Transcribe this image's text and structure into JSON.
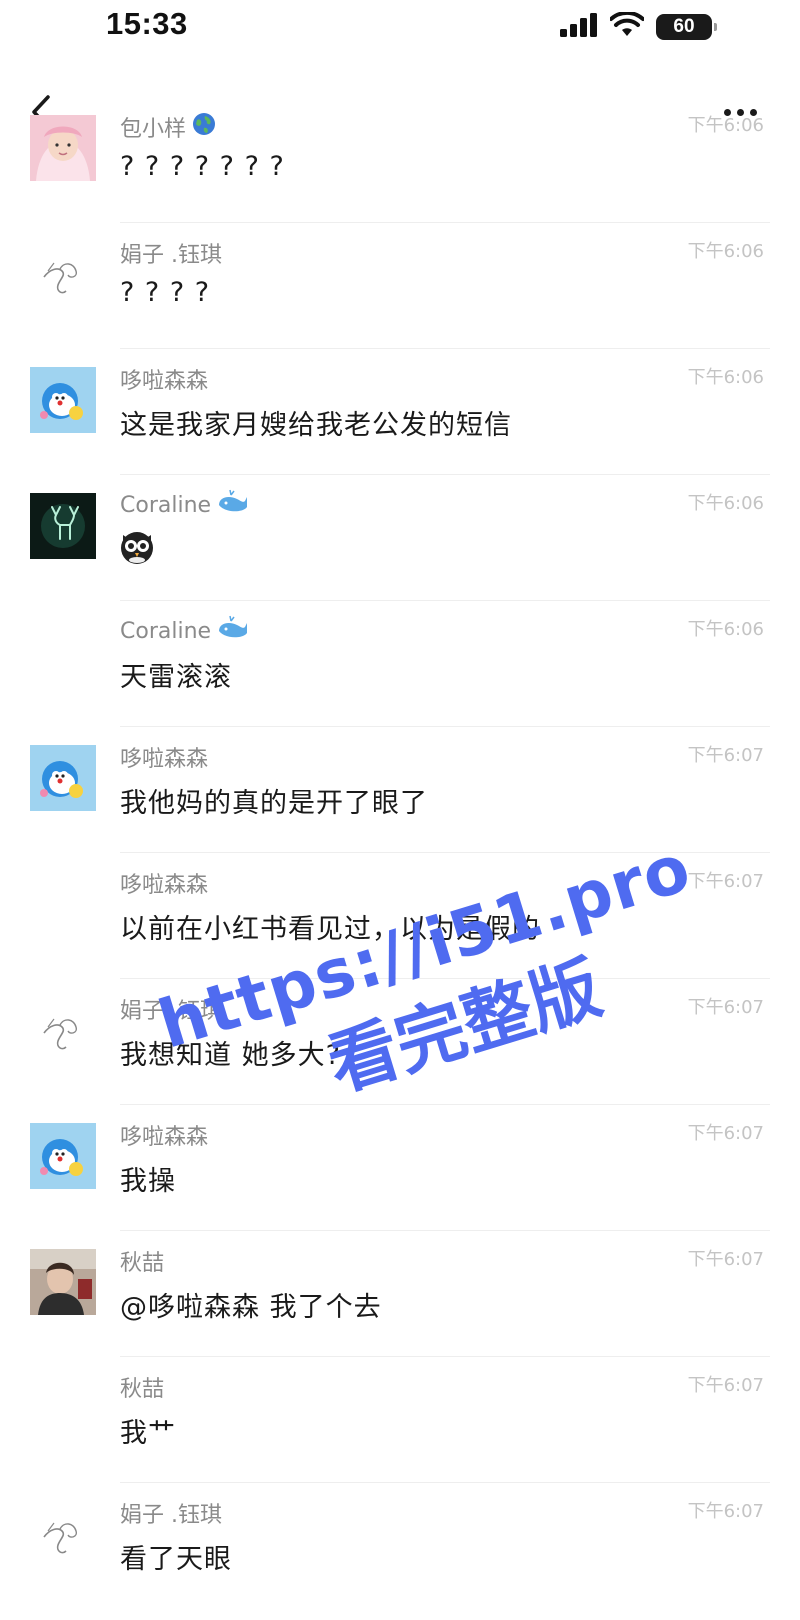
{
  "status_bar": {
    "time": "15:33",
    "battery": "60",
    "icons": [
      "signal-icon",
      "wifi-icon",
      "battery-icon"
    ]
  },
  "header": {
    "back_icon": "chevron-left-icon",
    "more_icon": "ellipsis-icon"
  },
  "messages": [
    {
      "name": "包小样",
      "badge": "globe-icon",
      "time": "下午6:06",
      "text": "? ? ? ? ? ? ?",
      "avatar": "baby-photo"
    },
    {
      "name": "娟子 .钰琪",
      "badge": "",
      "time": "下午6:06",
      "text": "? ? ? ?",
      "avatar": "sketch-logo"
    },
    {
      "name": "哆啦森森",
      "badge": "",
      "time": "下午6:06",
      "text": "这是我家月嫂给我老公发的短信",
      "avatar": "cartoon-blue"
    },
    {
      "name": "Coraline",
      "badge": "whale-icon",
      "time": "下午6:06",
      "text": "",
      "sticker": "owl-sticker",
      "avatar": "deer-photo"
    },
    {
      "name": "Coraline",
      "badge": "whale-icon",
      "time": "下午6:06",
      "text": "天雷滚滚",
      "avatar": ""
    },
    {
      "name": "哆啦森森",
      "badge": "",
      "time": "下午6:07",
      "text": "我他妈的真的是开了眼了",
      "avatar": "cartoon-blue"
    },
    {
      "name": "哆啦森森",
      "badge": "",
      "time": "下午6:07",
      "text": "以前在小红书看见过，以为是假的",
      "avatar": ""
    },
    {
      "name": "娟子 .钰琪",
      "badge": "",
      "time": "下午6:07",
      "text": "我想知道 她多大?",
      "avatar": "sketch-logo"
    },
    {
      "name": "哆啦森森",
      "badge": "",
      "time": "下午6:07",
      "text": "我操",
      "avatar": "cartoon-blue"
    },
    {
      "name": "秋喆",
      "badge": "",
      "time": "下午6:07",
      "text": "@哆啦森森 我了个去",
      "avatar": "person-photo"
    },
    {
      "name": "秋喆",
      "badge": "",
      "time": "下午6:07",
      "text": "我艹",
      "avatar": ""
    },
    {
      "name": "娟子 .钰琪",
      "badge": "",
      "time": "下午6:07",
      "text": "看了天眼",
      "avatar": "sketch-logo"
    }
  ],
  "watermark": {
    "line1": "https://i51.pro",
    "line2": "看完整版",
    "color": "#4f6bf0"
  }
}
